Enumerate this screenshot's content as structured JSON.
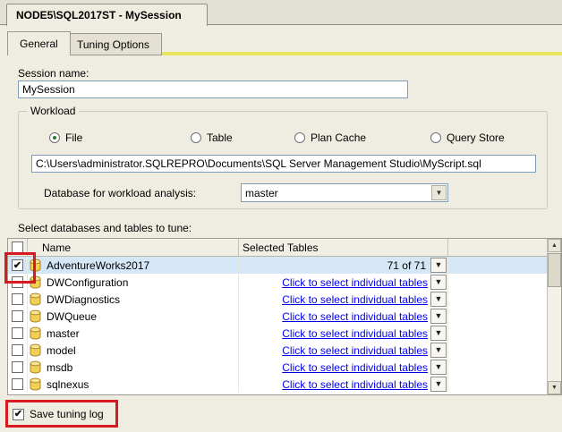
{
  "window": {
    "doc_tab": "NODE5\\SQL2017ST - MySession"
  },
  "tabs": [
    {
      "label": "General",
      "active": true
    },
    {
      "label": "Tuning Options",
      "active": false
    }
  ],
  "session": {
    "label": "Session name:",
    "value": "MySession"
  },
  "workload": {
    "group_label": "Workload",
    "options": [
      {
        "label": "File",
        "selected": true
      },
      {
        "label": "Table",
        "selected": false
      },
      {
        "label": "Plan Cache",
        "selected": false
      },
      {
        "label": "Query Store",
        "selected": false
      }
    ],
    "file_path": "C:\\Users\\administrator.SQLREPRO\\Documents\\SQL Server Management Studio\\MyScript.sql",
    "database_label": "Database for workload analysis:",
    "database_value": "master"
  },
  "tables_section": {
    "label": "Select databases and tables to tune:",
    "columns": [
      "Name",
      "Selected Tables"
    ],
    "rows": [
      {
        "name": "AdventureWorks2017",
        "checked": true,
        "highlighted": true,
        "is_link": false,
        "selected_tables": "71 of 71"
      },
      {
        "name": "DWConfiguration",
        "checked": false,
        "highlighted": false,
        "is_link": true,
        "selected_tables": "Click to select individual tables"
      },
      {
        "name": "DWDiagnostics",
        "checked": false,
        "highlighted": false,
        "is_link": true,
        "selected_tables": "Click to select individual tables"
      },
      {
        "name": "DWQueue",
        "checked": false,
        "highlighted": false,
        "is_link": true,
        "selected_tables": "Click to select individual tables"
      },
      {
        "name": "master",
        "checked": false,
        "highlighted": false,
        "is_link": true,
        "selected_tables": "Click to select individual tables"
      },
      {
        "name": "model",
        "checked": false,
        "highlighted": false,
        "is_link": true,
        "selected_tables": "Click to select individual tables"
      },
      {
        "name": "msdb",
        "checked": false,
        "highlighted": false,
        "is_link": true,
        "selected_tables": "Click to select individual tables"
      },
      {
        "name": "sqlnexus",
        "checked": false,
        "highlighted": false,
        "is_link": true,
        "selected_tables": "Click to select individual tables"
      }
    ]
  },
  "footer": {
    "save_tuning_log": "Save tuning log",
    "checked": true
  },
  "icons": {
    "database": "database-icon",
    "dropdown": "chevron-down-icon",
    "scroll_up": "arrow-up-icon",
    "scroll_down": "arrow-down-icon"
  },
  "colors": {
    "link": "#0000EE",
    "annotation_red": "#D71920",
    "selection_blue": "#D5E6F6",
    "tab_accent_yellow": "#E9E45E"
  }
}
